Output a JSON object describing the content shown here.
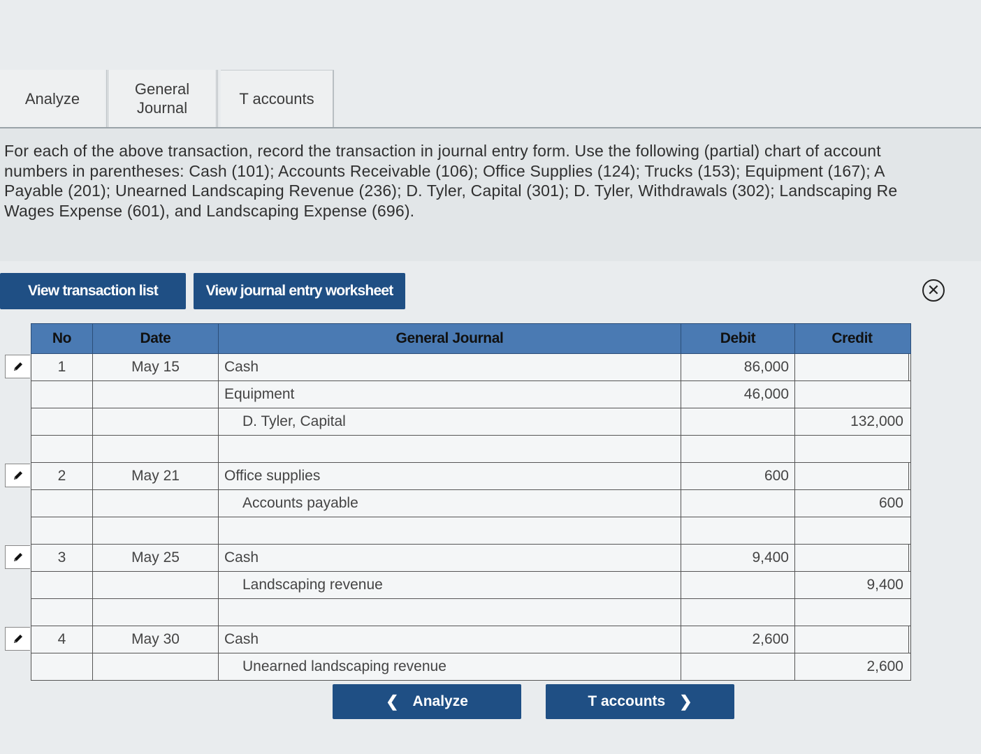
{
  "tabs": [
    "Analyze",
    "General Journal",
    "T accounts"
  ],
  "instructions": [
    "For each of the above transaction, record the transaction in journal entry form. Use the following (partial) chart of account",
    "numbers in parentheses: Cash (101); Accounts Receivable (106); Office Supplies (124); Trucks (153); Equipment (167); A",
    "Payable (201); Unearned Landscaping Revenue (236); D. Tyler, Capital (301); D. Tyler, Withdrawals (302); Landscaping Re",
    "Wages Expense (601), and Landscaping Expense (696)."
  ],
  "buttons": {
    "view_transaction_list": "View transaction list",
    "view_journal_worksheet": "View journal entry worksheet",
    "close": "✕"
  },
  "journal": {
    "headers": {
      "no": "No",
      "date": "Date",
      "general_journal": "General Journal",
      "debit": "Debit",
      "credit": "Credit"
    },
    "rows": [
      {
        "no": "1",
        "date": "May 15",
        "account": "Cash",
        "debit": "86,000",
        "credit": "",
        "indent": false,
        "edit": true
      },
      {
        "no": "",
        "date": "",
        "account": "Equipment",
        "debit": "46,000",
        "credit": "",
        "indent": false,
        "edit": false
      },
      {
        "no": "",
        "date": "",
        "account": "D. Tyler, Capital",
        "debit": "",
        "credit": "132,000",
        "indent": true,
        "edit": false
      },
      {
        "no": "",
        "date": "",
        "account": "",
        "debit": "",
        "credit": "",
        "indent": false,
        "edit": false
      },
      {
        "no": "2",
        "date": "May 21",
        "account": "Office supplies",
        "debit": "600",
        "credit": "",
        "indent": false,
        "edit": true
      },
      {
        "no": "",
        "date": "",
        "account": "Accounts payable",
        "debit": "",
        "credit": "600",
        "indent": true,
        "edit": false
      },
      {
        "no": "",
        "date": "",
        "account": "",
        "debit": "",
        "credit": "",
        "indent": false,
        "edit": false
      },
      {
        "no": "3",
        "date": "May 25",
        "account": "Cash",
        "debit": "9,400",
        "credit": "",
        "indent": false,
        "edit": true
      },
      {
        "no": "",
        "date": "",
        "account": "Landscaping revenue",
        "debit": "",
        "credit": "9,400",
        "indent": true,
        "edit": false
      },
      {
        "no": "",
        "date": "",
        "account": "",
        "debit": "",
        "credit": "",
        "indent": false,
        "edit": false
      },
      {
        "no": "4",
        "date": "May 30",
        "account": "Cash",
        "debit": "2,600",
        "credit": "",
        "indent": false,
        "edit": true
      },
      {
        "no": "",
        "date": "",
        "account": "Unearned landscaping revenue",
        "debit": "",
        "credit": "2,600",
        "indent": true,
        "edit": false
      }
    ]
  },
  "nav": {
    "prev_label": "Analyze",
    "next_label": "T accounts",
    "prev_icon": "chevron-left-icon",
    "next_icon": "chevron-right-icon"
  },
  "colors": {
    "button": "#1f4f84",
    "header": "#4a7ab3",
    "background": "#e9ecee"
  }
}
